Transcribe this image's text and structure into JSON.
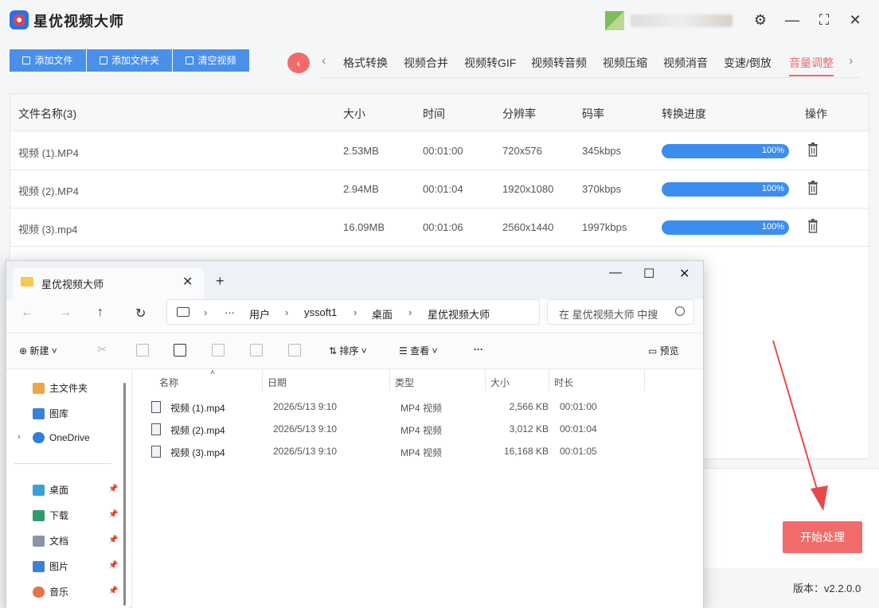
{
  "app": {
    "title": "星优视频大师",
    "window_controls": [
      "settings-icon",
      "minimize-icon",
      "maximize-icon",
      "close-icon"
    ]
  },
  "toolbar": {
    "add_file": "添加文件",
    "add_folder": "添加文件夹",
    "clear_videos": "清空视频"
  },
  "tabs": {
    "items": [
      "格式转换",
      "视频合并",
      "视频转GIF",
      "视频转音频",
      "视频压缩",
      "视频消音",
      "变速/倒放",
      "音量调整"
    ],
    "active": "音量调整"
  },
  "table": {
    "headers": [
      "文件名称(3)",
      "大小",
      "时间",
      "分辨率",
      "码率",
      "转换进度",
      "操作"
    ],
    "rows": [
      {
        "name": "视频 (1).MP4",
        "size": "2.53MB",
        "time": "00:01:00",
        "resolution": "720x576",
        "bitrate": "345kbps",
        "progress_label": "100%",
        "progress": 1.0
      },
      {
        "name": "视频 (2).MP4",
        "size": "2.94MB",
        "time": "00:01:04",
        "resolution": "1920x1080",
        "bitrate": "370kbps",
        "progress_label": "100%",
        "progress": 1.0
      },
      {
        "name": "视频 (3).mp4",
        "size": "16.09MB",
        "time": "00:01:06",
        "resolution": "2560x1440",
        "bitrate": "1997kbps",
        "progress_label": "100%",
        "progress": 1.0
      }
    ]
  },
  "start_button": "开始处理",
  "version": "版本：v2.2.0.0",
  "colors": {
    "accent": "#f26b6b",
    "primary": "#4a90e8",
    "progress": "#3b8ef0"
  },
  "explorer": {
    "tab_title": "星优视频大师",
    "breadcrumb": [
      "用户",
      "yssoft1",
      "桌面",
      "星优视频大师"
    ],
    "search_placeholder": "在 星优视频大师 中搜索",
    "commands": {
      "new": "新建",
      "sort": "排序",
      "view": "查看",
      "more": "···",
      "preview": "预览"
    },
    "sidebar": {
      "top": [
        "主文件夹",
        "图库",
        "OneDrive"
      ],
      "pinned": [
        "桌面",
        "下载",
        "文档",
        "图片",
        "音乐"
      ]
    },
    "columns": [
      "名称",
      "日期",
      "类型",
      "大小",
      "时长"
    ],
    "files": [
      {
        "name": "视频 (1).mp4",
        "date": "2026/5/13 9:10",
        "type": "MP4 视频",
        "size": "2,566 KB",
        "duration": "00:01:00"
      },
      {
        "name": "视频 (2).mp4",
        "date": "2026/5/13 9:10",
        "type": "MP4 视频",
        "size": "3,012 KB",
        "duration": "00:01:04"
      },
      {
        "name": "视频 (3).mp4",
        "date": "2026/5/13 9:10",
        "type": "MP4 视频",
        "size": "16,168 KB",
        "duration": "00:01:05"
      }
    ]
  }
}
